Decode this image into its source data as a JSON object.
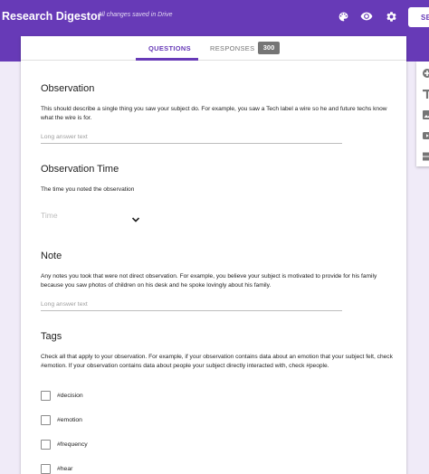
{
  "header": {
    "title": "Research Digestor",
    "save_status": "All changes saved in Drive",
    "icons": [
      "palette-icon",
      "eye-icon",
      "gear-icon"
    ],
    "send_label": "SE"
  },
  "tabs": [
    {
      "label": "QUESTIONS",
      "active": true
    },
    {
      "label": "RESPONSES",
      "active": false,
      "badge": "300"
    }
  ],
  "questions": [
    {
      "title": "Observation",
      "description": "This should describe a single thing you saw your subject do. For example, you saw a Tech label a wire so he and future techs know what the wire is for.",
      "placeholder": "Long answer text"
    },
    {
      "title": "Observation Time",
      "description": "The time you noted the observation",
      "placeholder": "Time"
    },
    {
      "title": "Note",
      "description": "Any notes you took that were not direct observation. For example, you believe your subject is motivated to provide for his family because you saw photos of children on his desk and he spoke lovingly about his family.",
      "placeholder": "Long answer text"
    },
    {
      "title": "Tags",
      "description": "Check all that apply to your observation. For example, if your observation contains data about an emotion that your subject felt, check #emotion. If your observation contains data about people your subject directly interacted with, check #people.",
      "options": [
        "#decision",
        "#emotion",
        "#frequency",
        "#hear"
      ]
    }
  ],
  "side_toolbar": {
    "icons": [
      "add-circle-icon",
      "text-title-icon",
      "image-icon",
      "video-icon",
      "section-icon"
    ]
  },
  "colors": {
    "accent": "#673ab7",
    "background": "#f0ebf8"
  }
}
